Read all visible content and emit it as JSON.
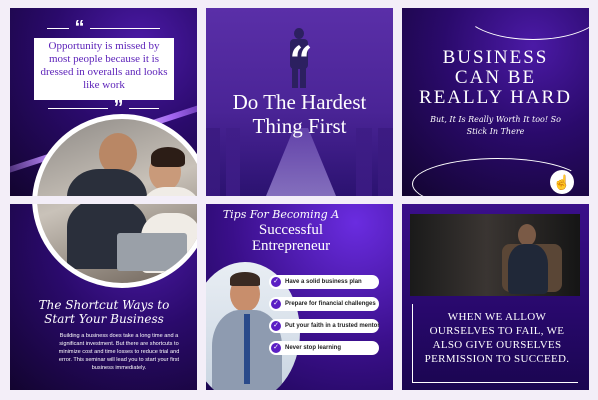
{
  "tile1": {
    "quote": "Opportunity is missed by most people because it is dressed in overalls and looks like work",
    "quote_open_icon": "quote-open-icon",
    "quote_close_icon": "quote-close-icon"
  },
  "tile2": {
    "title": "Do The Hardest Thing First",
    "quote_icon": "quote-icon"
  },
  "tile3": {
    "title_lines": [
      "BUSINESS",
      "CAN BE",
      "REALLY HARD"
    ],
    "subtitle": "But, It Is Really Worth It too! So Stick In There",
    "pointer_icon": "hand-pointer-icon"
  },
  "tile4": {
    "title": "The Shortcut Ways to Start Your Business",
    "body": "Building a business does take a long time and a significant investment. But there are shortcuts to minimize cost and time losses to reduce trial and error. This seminar will lead you to start your first business immediately."
  },
  "tile5": {
    "title_script": "Tips For Becoming A",
    "title_main": "Successful Entrepreneur",
    "tips": [
      "Have a solid business plan",
      "Prepare for financial challenges",
      "Put your faith in a trusted mentor",
      "Never stop learning"
    ],
    "check_icon": "check-icon"
  },
  "tile6": {
    "quote": "WHEN WE ALLOW OURSELVES TO FAIL, WE ALSO GIVE OURSELVES PERMISSION TO SUCCEED."
  },
  "colors": {
    "accent": "#7a2cf0",
    "deep_purple": "#1e0750",
    "white": "#ffffff"
  }
}
